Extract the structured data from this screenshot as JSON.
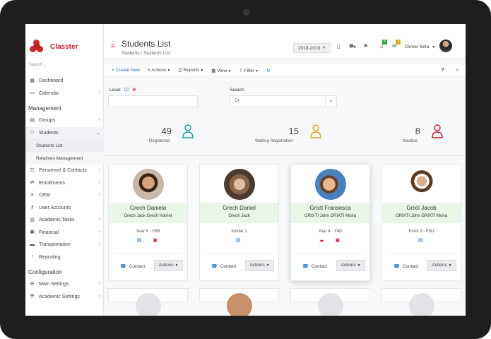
{
  "brand": {
    "name": "Classter"
  },
  "sidebar": {
    "search_placeholder": "Search...",
    "items_top": [
      {
        "label": "Dashboard",
        "icon": "dashboard-icon"
      },
      {
        "label": "Calendar",
        "icon": "calendar-icon"
      }
    ],
    "management_heading": "Management",
    "items_mgmt": [
      {
        "label": "Groups",
        "icon": "groups-icon"
      },
      {
        "label": "Students",
        "icon": "student-icon"
      }
    ],
    "students_sub": [
      {
        "label": "Students List"
      },
      {
        "label": "Relatives Management"
      }
    ],
    "items_mgmt2": [
      {
        "label": "Personnel & Contacts",
        "icon": "personnel-icon"
      },
      {
        "label": "Enrollments",
        "icon": "enrollments-icon"
      },
      {
        "label": "CRM",
        "icon": "crm-icon"
      },
      {
        "label": "User Accounts",
        "icon": "key-icon"
      },
      {
        "label": "Academic Tasks",
        "icon": "tasks-icon"
      },
      {
        "label": "Financial",
        "icon": "financial-icon"
      },
      {
        "label": "Transportation",
        "icon": "bus-icon"
      },
      {
        "label": "Reporting",
        "icon": "reporting-icon"
      }
    ],
    "configuration_heading": "Configuration",
    "items_config": [
      {
        "label": "Main Settings",
        "icon": "settings-icon"
      },
      {
        "label": "Academic Settings",
        "icon": "settings-icon"
      }
    ]
  },
  "header": {
    "title": "Students List",
    "breadcrumb": "Students / Students List",
    "year": "2018-2019",
    "badge_notifications": "4",
    "badge_messages": "1",
    "owner": "Owner Beta"
  },
  "toolbar": {
    "create_new": "+ Create New",
    "actions": "Actions",
    "reports": "Reports",
    "view": "View",
    "filter": "Filter",
    "help": "?"
  },
  "filters": {
    "level_label": "Level",
    "search_label": "Search",
    "search_value": "Gr"
  },
  "stats": [
    {
      "value": "49",
      "label": "Registered",
      "color": "#1aa39a"
    },
    {
      "value": "15",
      "label": "Waiting Registration",
      "color": "#d8a424"
    },
    {
      "value": "8",
      "label": "Inactive",
      "color": "#c8202a"
    }
  ],
  "cards": [
    {
      "name": "Grech Daniela",
      "parents": "Grech Jack Grech Harriet",
      "year": "Year 6 - Y6B"
    },
    {
      "name": "Grech Daniel",
      "parents": "Grech Jack",
      "year": "Kinder 1"
    },
    {
      "name": "Grixti Fransesca",
      "parents": "GRIXTI John GRIXTI Moira",
      "year": "Year 4 - Y4D"
    },
    {
      "name": "Grixti Jacob",
      "parents": "GRIXTI John GRIXTI Moira",
      "year": "Form 3 - F3D"
    }
  ],
  "card_labels": {
    "contact": "Contact",
    "actions": "Actions"
  }
}
